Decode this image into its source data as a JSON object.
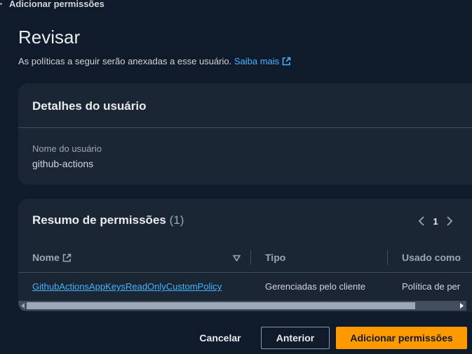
{
  "wizard": {
    "title": "Adicionar permissões"
  },
  "page": {
    "title": "Revisar",
    "description": "As políticas a seguir serão anexadas a esse usuário.",
    "learn_more": "Saiba mais"
  },
  "user_details": {
    "title": "Detalhes do usuário",
    "name_label": "Nome do usuário",
    "name_value": "github-actions"
  },
  "permissions": {
    "title": "Resumo de permissões",
    "count": "(1)",
    "page": "1",
    "columns": [
      "Nome",
      "Tipo",
      "Usado como"
    ],
    "rows": [
      {
        "name": "GithubActionsAppKeysReadOnlyCustomPolicy",
        "type": "Gerenciadas pelo cliente",
        "used_as": "Política de per"
      }
    ]
  },
  "actions": {
    "cancel": "Cancelar",
    "previous": "Anterior",
    "submit": "Adicionar permissões"
  },
  "colors": {
    "accent": "#ff9900",
    "link": "#42b4ff",
    "background": "#0f1b2a",
    "panel": "#1b2634"
  },
  "icons": [
    "external-link-icon",
    "chevron-left-icon",
    "chevron-right-icon",
    "sort-down-icon"
  ]
}
